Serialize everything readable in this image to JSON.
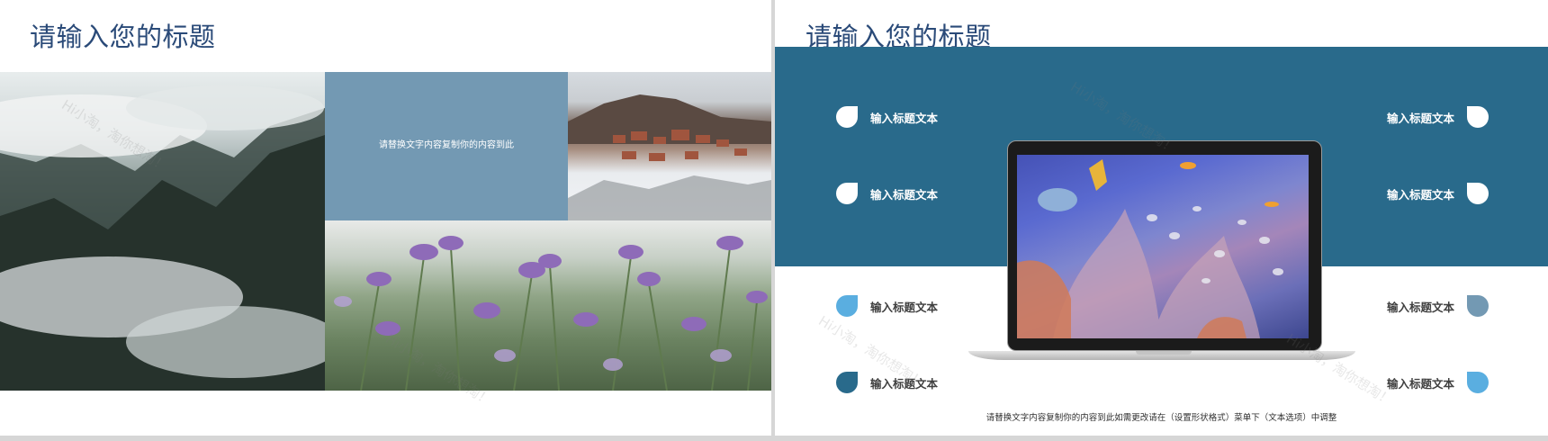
{
  "slide1": {
    "title": "请输入您的标题",
    "caption": "请替换文字内容复制你的内容到此",
    "box_color": "#7399b3",
    "watermark": "Hi小淘，淘你想淘！"
  },
  "slide2": {
    "title": "请输入您的标题",
    "band_color": "#296a8b",
    "left_items": [
      {
        "label": "输入标题文本",
        "color": "#ffffff"
      },
      {
        "label": "输入标题文本",
        "color": "#ffffff"
      },
      {
        "label": "输入标题文本",
        "color": "#5aaee0"
      },
      {
        "label": "输入标题文本",
        "color": "#296a8b"
      }
    ],
    "right_items": [
      {
        "label": "输入标题文本",
        "color": "#ffffff"
      },
      {
        "label": "输入标题文本",
        "color": "#ffffff"
      },
      {
        "label": "输入标题文本",
        "color": "#7399b3"
      },
      {
        "label": "输入标题文本",
        "color": "#5aaee0"
      }
    ],
    "footer": "请替换文字内容复制你的内容到此如需更改请在（设置形状格式）菜单下（文本选项）中调整",
    "watermark": "Hi小淘，淘你想淘！"
  }
}
